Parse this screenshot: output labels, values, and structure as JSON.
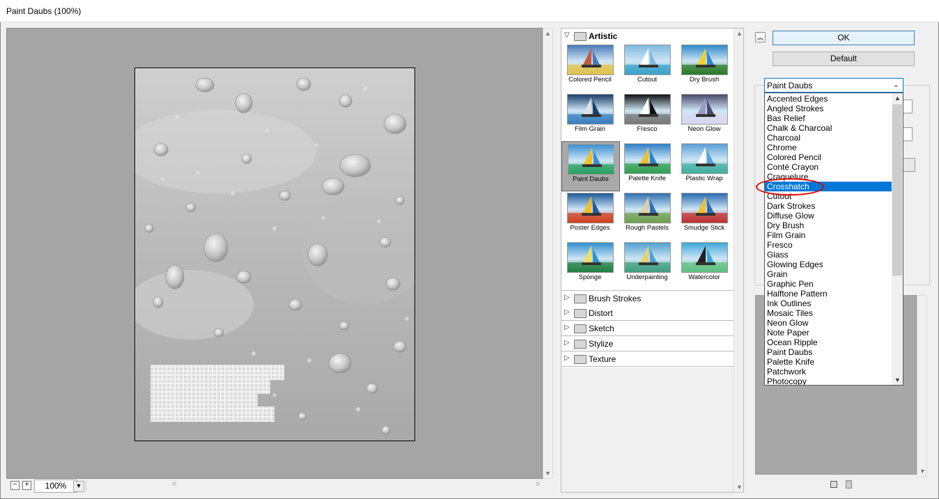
{
  "window": {
    "title": "Paint Daubs (100%)"
  },
  "preview": {
    "zoom": "100%",
    "zoom_out": "−",
    "zoom_in": "+"
  },
  "gallery": {
    "open_category": "Artistic",
    "thumbnails": [
      {
        "label": "Colored Pencil"
      },
      {
        "label": "Cutout"
      },
      {
        "label": "Dry Brush"
      },
      {
        "label": "Film Grain"
      },
      {
        "label": "Fresco"
      },
      {
        "label": "Neon Glow"
      },
      {
        "label": "Paint Daubs"
      },
      {
        "label": "Palette Knife"
      },
      {
        "label": "Plastic Wrap"
      },
      {
        "label": "Poster Edges"
      },
      {
        "label": "Rough Pastels"
      },
      {
        "label": "Smudge Stick"
      },
      {
        "label": "Sponge"
      },
      {
        "label": "Underpainting"
      },
      {
        "label": "Watercolor"
      }
    ],
    "selected_thumbnail": "Paint Daubs",
    "categories": [
      {
        "label": "Brush Strokes"
      },
      {
        "label": "Distort"
      },
      {
        "label": "Sketch"
      },
      {
        "label": "Stylize"
      },
      {
        "label": "Texture"
      }
    ]
  },
  "buttons": {
    "ok": "OK",
    "default": "Default"
  },
  "filter_select": {
    "value": "Paint Daubs",
    "options": [
      "Accented Edges",
      "Angled Strokes",
      "Bas Relief",
      "Chalk & Charcoal",
      "Charcoal",
      "Chrome",
      "Colored Pencil",
      "Conté Crayon",
      "Craquelure",
      "Crosshatch",
      "Cutout",
      "Dark Strokes",
      "Diffuse Glow",
      "Dry Brush",
      "Film Grain",
      "Fresco",
      "Glass",
      "Glowing Edges",
      "Grain",
      "Graphic Pen",
      "Halftone Pattern",
      "Ink Outlines",
      "Mosaic Tiles",
      "Neon Glow",
      "Note Paper",
      "Ocean Ripple",
      "Paint Daubs",
      "Palette Knife",
      "Patchwork",
      "Photocopy"
    ],
    "highlighted": "Crosshatch"
  },
  "colors": {
    "highlight": "#0078d7",
    "annotation": "#e00000",
    "preview_bg": "#a5a5a5"
  }
}
